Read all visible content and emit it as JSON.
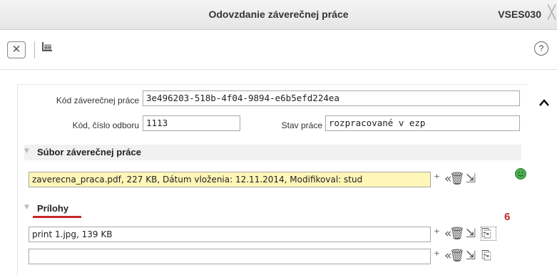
{
  "window": {
    "title": "Odovzdanie záverečnej práce",
    "code": "VSES030",
    "close_glyph": "╳"
  },
  "toolbar": {
    "close_glyph": "✕",
    "tree_glyph": "⊞",
    "help_glyph": "?"
  },
  "form": {
    "thesis_code_label": "Kód záverečnej práce",
    "thesis_code_value": "3e496203-518b-4f04-9894-e6b5efd224ea",
    "dept_code_label": "Kód, číslo odboru",
    "dept_code_value": "1113",
    "status_label": "Stav práce",
    "status_value": "rozpracované v ezp"
  },
  "file_section": {
    "title": "Súbor záverečnej práce",
    "file_value": "zaverecna_praca.pdf, 227 KB, Dátum vloženia: 12.11.2014, Modifikoval: stud",
    "highlight_color": "#fff6b8"
  },
  "attachments_section": {
    "title": "Prílohy",
    "badge": "6",
    "rows": [
      {
        "value": "print 1.jpg, 139 KB"
      },
      {
        "value": ""
      }
    ]
  },
  "icons": {
    "remove_all": "remove-all-icon",
    "delete": "trash-icon",
    "import": "import-icon",
    "add_file": "add-file-icon",
    "scroll_up": "chevron-up-icon",
    "status_ok": "smiley-icon"
  }
}
